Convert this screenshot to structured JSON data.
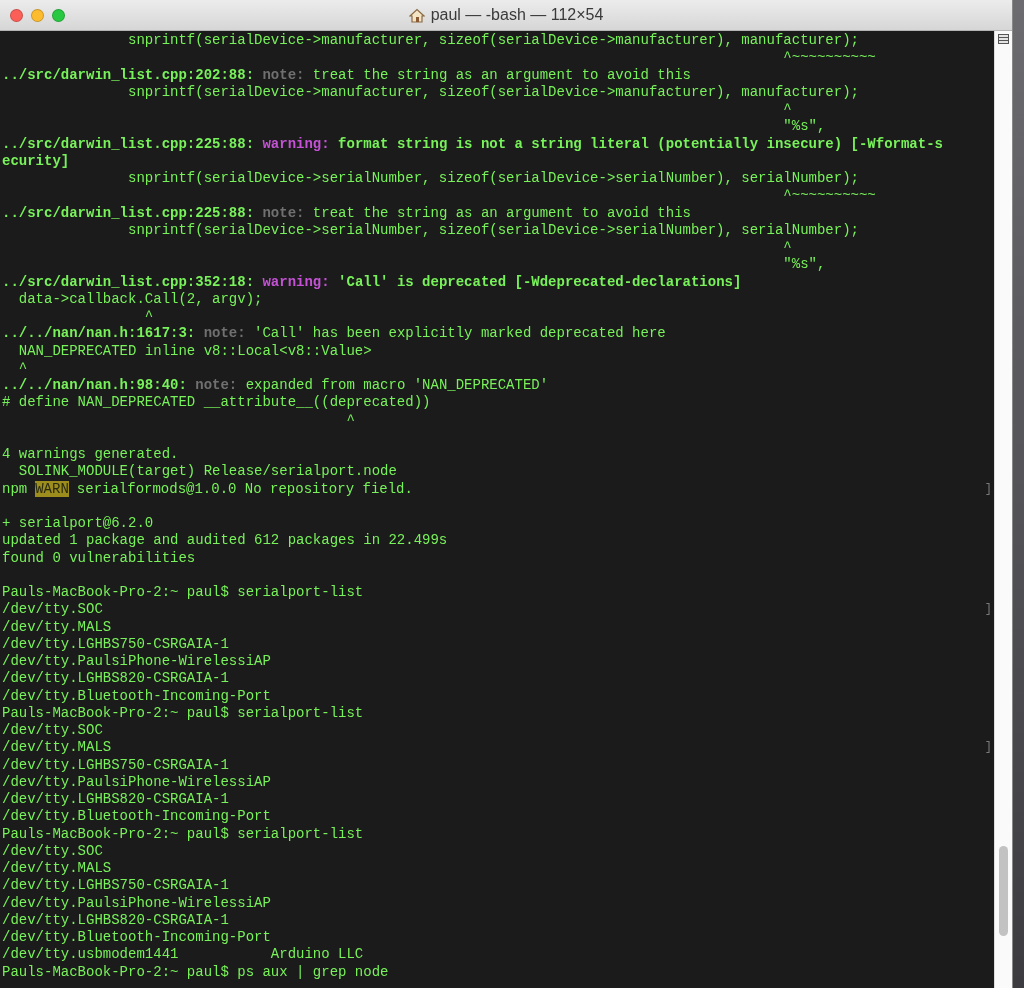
{
  "window": {
    "title": "paul — -bash — 112×54"
  },
  "lines": [
    {
      "kind": "text",
      "segments": [
        {
          "kind": "plain",
          "text": "               snprintf(serialDevice->manufacturer, sizeof(serialDevice->manufacturer), manufacturer);"
        }
      ]
    },
    {
      "kind": "text",
      "segments": [
        {
          "kind": "plain",
          "text": "                                                                                             ^~~~~~~~~~~"
        }
      ]
    },
    {
      "kind": "text",
      "segments": [
        {
          "kind": "path",
          "text": "../src/darwin_list.cpp:202:88:"
        },
        {
          "kind": "note",
          "text": " note:"
        },
        {
          "kind": "plain",
          "text": " treat the string as an argument to avoid this"
        }
      ]
    },
    {
      "kind": "text",
      "segments": [
        {
          "kind": "plain",
          "text": "               snprintf(serialDevice->manufacturer, sizeof(serialDevice->manufacturer), manufacturer);"
        }
      ]
    },
    {
      "kind": "text",
      "segments": [
        {
          "kind": "plain",
          "text": "                                                                                             ^"
        }
      ]
    },
    {
      "kind": "text",
      "segments": [
        {
          "kind": "plain",
          "text": "                                                                                             \"%s\","
        }
      ]
    },
    {
      "kind": "text",
      "segments": [
        {
          "kind": "path",
          "text": "../src/darwin_list.cpp:225:88:"
        },
        {
          "kind": "warning",
          "text": " warning:"
        },
        {
          "kind": "message",
          "text": " format string is not a string literal (potentially insecure) [-Wformat-s"
        }
      ]
    },
    {
      "kind": "text",
      "segments": [
        {
          "kind": "message",
          "text": "ecurity]"
        }
      ]
    },
    {
      "kind": "text",
      "segments": [
        {
          "kind": "plain",
          "text": "               snprintf(serialDevice->serialNumber, sizeof(serialDevice->serialNumber), serialNumber);"
        }
      ]
    },
    {
      "kind": "text",
      "segments": [
        {
          "kind": "plain",
          "text": "                                                                                             ^~~~~~~~~~~"
        }
      ]
    },
    {
      "kind": "text",
      "segments": [
        {
          "kind": "path",
          "text": "../src/darwin_list.cpp:225:88:"
        },
        {
          "kind": "note",
          "text": " note:"
        },
        {
          "kind": "plain",
          "text": " treat the string as an argument to avoid this"
        }
      ]
    },
    {
      "kind": "text",
      "segments": [
        {
          "kind": "plain",
          "text": "               snprintf(serialDevice->serialNumber, sizeof(serialDevice->serialNumber), serialNumber);"
        }
      ]
    },
    {
      "kind": "text",
      "segments": [
        {
          "kind": "plain",
          "text": "                                                                                             ^"
        }
      ]
    },
    {
      "kind": "text",
      "segments": [
        {
          "kind": "plain",
          "text": "                                                                                             \"%s\","
        }
      ]
    },
    {
      "kind": "text",
      "segments": [
        {
          "kind": "path",
          "text": "../src/darwin_list.cpp:352:18:"
        },
        {
          "kind": "warning",
          "text": " warning:"
        },
        {
          "kind": "message",
          "text": " 'Call' is deprecated [-Wdeprecated-declarations]"
        }
      ]
    },
    {
      "kind": "text",
      "segments": [
        {
          "kind": "plain",
          "text": "  data->callback.Call(2, argv);"
        }
      ]
    },
    {
      "kind": "text",
      "segments": [
        {
          "kind": "plain",
          "text": "                 ^"
        }
      ]
    },
    {
      "kind": "text",
      "segments": [
        {
          "kind": "path",
          "text": "../../nan/nan.h:1617:3:"
        },
        {
          "kind": "note",
          "text": " note:"
        },
        {
          "kind": "plain",
          "text": " 'Call' has been explicitly marked deprecated here"
        }
      ]
    },
    {
      "kind": "text",
      "segments": [
        {
          "kind": "plain",
          "text": "  NAN_DEPRECATED inline v8::Local<v8::Value>"
        }
      ]
    },
    {
      "kind": "text",
      "segments": [
        {
          "kind": "plain",
          "text": "  ^"
        }
      ]
    },
    {
      "kind": "text",
      "segments": [
        {
          "kind": "path",
          "text": "../../nan/nan.h:98:40:"
        },
        {
          "kind": "note",
          "text": " note:"
        },
        {
          "kind": "plain",
          "text": " expanded from macro 'NAN_DEPRECATED'"
        }
      ]
    },
    {
      "kind": "text",
      "segments": [
        {
          "kind": "plain",
          "text": "# define NAN_DEPRECATED __attribute__((deprecated))"
        }
      ]
    },
    {
      "kind": "text",
      "segments": [
        {
          "kind": "plain",
          "text": "                                         ^"
        }
      ]
    },
    {
      "kind": "blank"
    },
    {
      "kind": "text",
      "segments": [
        {
          "kind": "plain",
          "text": "4 warnings generated."
        }
      ]
    },
    {
      "kind": "text",
      "segments": [
        {
          "kind": "plain",
          "text": "  SOLINK_MODULE(target) Release/serialport.node"
        }
      ]
    },
    {
      "kind": "text",
      "edge": "]",
      "segments": [
        {
          "kind": "plain",
          "text": "npm"
        },
        {
          "kind": "badge",
          "text": "WARN"
        },
        {
          "kind": "plain",
          "text": "serialformods@1.0.0 No repository field."
        }
      ]
    },
    {
      "kind": "blank"
    },
    {
      "kind": "text",
      "segments": [
        {
          "kind": "plain",
          "text": "+ serialport@6.2.0"
        }
      ]
    },
    {
      "kind": "text",
      "segments": [
        {
          "kind": "plain",
          "text": "updated 1 package and audited 612 packages in 22.499s"
        }
      ]
    },
    {
      "kind": "text",
      "segments": [
        {
          "kind": "plain",
          "text": "found 0 vulnerabilities"
        }
      ]
    },
    {
      "kind": "blank"
    },
    {
      "kind": "text",
      "segments": [
        {
          "kind": "plain",
          "text": "Pauls-MacBook-Pro-2:~ paul$ serialport-list"
        }
      ]
    },
    {
      "kind": "text",
      "edge": "]",
      "segments": [
        {
          "kind": "plain",
          "text": "/dev/tty.SOC"
        }
      ]
    },
    {
      "kind": "text",
      "segments": [
        {
          "kind": "plain",
          "text": "/dev/tty.MALS"
        }
      ]
    },
    {
      "kind": "text",
      "segments": [
        {
          "kind": "plain",
          "text": "/dev/tty.LGHBS750-CSRGAIA-1"
        }
      ]
    },
    {
      "kind": "text",
      "segments": [
        {
          "kind": "plain",
          "text": "/dev/tty.PaulsiPhone-WirelessiAP"
        }
      ]
    },
    {
      "kind": "text",
      "segments": [
        {
          "kind": "plain",
          "text": "/dev/tty.LGHBS820-CSRGAIA-1"
        }
      ]
    },
    {
      "kind": "text",
      "segments": [
        {
          "kind": "plain",
          "text": "/dev/tty.Bluetooth-Incoming-Port"
        }
      ]
    },
    {
      "kind": "text",
      "segments": [
        {
          "kind": "plain",
          "text": "Pauls-MacBook-Pro-2:~ paul$ serialport-list"
        }
      ]
    },
    {
      "kind": "text",
      "segments": [
        {
          "kind": "plain",
          "text": "/dev/tty.SOC"
        }
      ]
    },
    {
      "kind": "text",
      "edge": "]",
      "segments": [
        {
          "kind": "plain",
          "text": "/dev/tty.MALS"
        }
      ]
    },
    {
      "kind": "text",
      "segments": [
        {
          "kind": "plain",
          "text": "/dev/tty.LGHBS750-CSRGAIA-1"
        }
      ]
    },
    {
      "kind": "text",
      "segments": [
        {
          "kind": "plain",
          "text": "/dev/tty.PaulsiPhone-WirelessiAP"
        }
      ]
    },
    {
      "kind": "text",
      "segments": [
        {
          "kind": "plain",
          "text": "/dev/tty.LGHBS820-CSRGAIA-1"
        }
      ]
    },
    {
      "kind": "text",
      "segments": [
        {
          "kind": "plain",
          "text": "/dev/tty.Bluetooth-Incoming-Port"
        }
      ]
    },
    {
      "kind": "text",
      "segments": [
        {
          "kind": "plain",
          "text": "Pauls-MacBook-Pro-2:~ paul$ serialport-list"
        }
      ]
    },
    {
      "kind": "text",
      "segments": [
        {
          "kind": "plain",
          "text": "/dev/tty.SOC"
        }
      ]
    },
    {
      "kind": "text",
      "segments": [
        {
          "kind": "plain",
          "text": "/dev/tty.MALS"
        }
      ]
    },
    {
      "kind": "text",
      "segments": [
        {
          "kind": "plain",
          "text": "/dev/tty.LGHBS750-CSRGAIA-1"
        }
      ]
    },
    {
      "kind": "text",
      "segments": [
        {
          "kind": "plain",
          "text": "/dev/tty.PaulsiPhone-WirelessiAP"
        }
      ]
    },
    {
      "kind": "text",
      "segments": [
        {
          "kind": "plain",
          "text": "/dev/tty.LGHBS820-CSRGAIA-1"
        }
      ]
    },
    {
      "kind": "text",
      "segments": [
        {
          "kind": "plain",
          "text": "/dev/tty.Bluetooth-Incoming-Port"
        }
      ]
    },
    {
      "kind": "text",
      "segments": [
        {
          "kind": "plain",
          "text": "/dev/tty.usbmodem1441"
        },
        {
          "kind": "plain",
          "text": "Arduino LLC"
        }
      ]
    },
    {
      "kind": "text",
      "segments": [
        {
          "kind": "plain",
          "text": "Pauls-MacBook-Pro-2:~ paul$ ps aux | grep node"
        }
      ]
    }
  ]
}
